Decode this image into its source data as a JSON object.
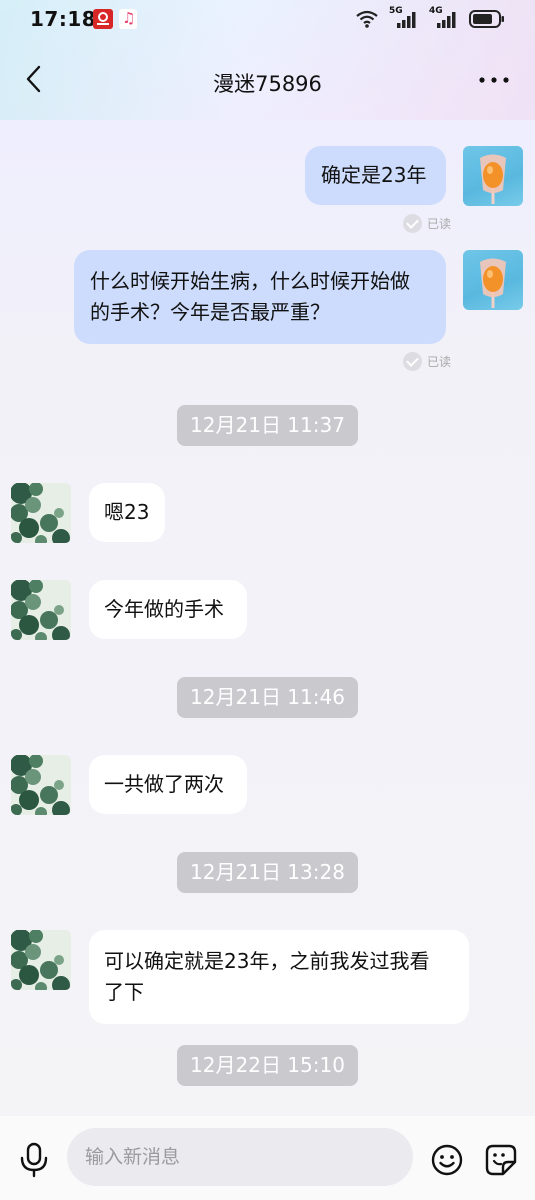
{
  "status_bar": {
    "time": "17:18",
    "network_1": "5G",
    "network_2": "4G"
  },
  "header": {
    "title": "漫迷75896"
  },
  "messages": [
    {
      "from": "me",
      "text": "确定是23年",
      "status": "已读"
    },
    {
      "from": "me",
      "text": "什么时候开始生病，什么时候开始做的手术？今年是否最严重？",
      "status": "已读"
    },
    {
      "timestamp": "12月21日 11:37"
    },
    {
      "from": "them",
      "text": "嗯23"
    },
    {
      "from": "them",
      "text": "今年做的手术"
    },
    {
      "timestamp": "12月21日 11:46"
    },
    {
      "from": "them",
      "text": "一共做了两次"
    },
    {
      "timestamp": "12月21日 13:28"
    },
    {
      "from": "them",
      "text": "可以确定就是23年，之前我发过我看了下"
    },
    {
      "timestamp": "12月22日 15:10"
    }
  ],
  "input_bar": {
    "placeholder": "输入新消息"
  },
  "colors": {
    "bubble_me": "#cddcfd",
    "bubble_them": "#ffffff",
    "timestamp_bg": "#c9c9ce"
  }
}
